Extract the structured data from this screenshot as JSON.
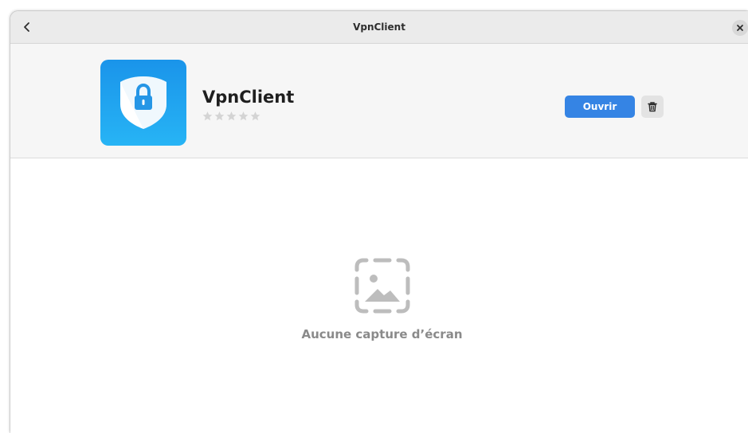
{
  "window": {
    "title": "VpnClient"
  },
  "header": {
    "back_icon": "chevron-left-icon",
    "close_icon": "close-icon"
  },
  "app": {
    "name": "VpnClient",
    "icon": "vpn-shield-lock-icon",
    "rating_stars": 0,
    "rating_max": 5,
    "open_label": "Ouvrir",
    "delete_icon": "trash-icon"
  },
  "screenshots": {
    "empty_icon": "image-placeholder-icon",
    "empty_label": "Aucune capture d’écran"
  },
  "colors": {
    "accent": "#3584e4",
    "app_icon_top": "#1a94ea",
    "app_icon_bottom": "#27b4f5",
    "star_empty": "#d4d4d4",
    "empty_text": "#8a8a8a"
  }
}
